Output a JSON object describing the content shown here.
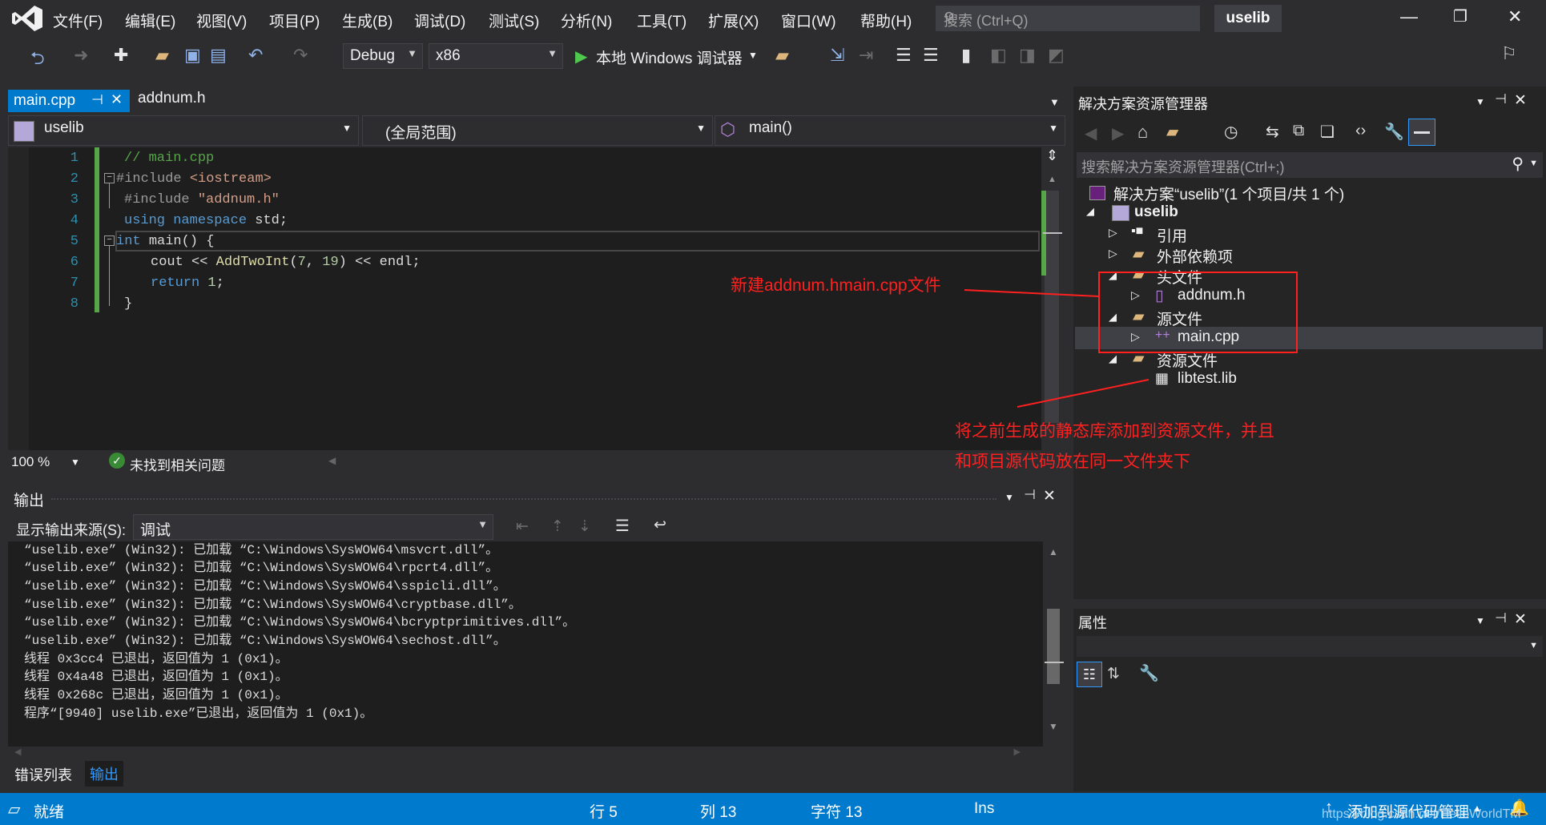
{
  "menu": [
    "文件(F)",
    "编辑(E)",
    "视图(V)",
    "项目(P)",
    "生成(B)",
    "调试(D)",
    "测试(S)",
    "分析(N)",
    "工具(T)",
    "扩展(X)",
    "窗口(W)",
    "帮助(H)"
  ],
  "search": {
    "placeholder": "搜索 (Ctrl+Q)"
  },
  "project_title": "uselib",
  "toolbar": {
    "config": "Debug",
    "platform": "x86",
    "debugger": "本地 Windows 调试器"
  },
  "editor": {
    "tabs": [
      {
        "label": "main.cpp",
        "active": true
      },
      {
        "label": "addnum.h",
        "active": false
      }
    ],
    "nav_project": "uselib",
    "nav_scope": "(全局范围)",
    "nav_member": "main()",
    "line_numbers": [
      "1",
      "2",
      "3",
      "4",
      "5",
      "6",
      "7",
      "8"
    ],
    "code": {
      "l1": "// main.cpp",
      "l2_kw": "#include",
      "l2_str": "<iostream>",
      "l3_kw": "#include",
      "l3_str": "\"addnum.h\"",
      "l4_using": "using",
      "l4_ns": "namespace",
      "l4_rest": "std;",
      "l5_int": "int",
      "l5_rest": "main() {",
      "l6_cout": "cout << ",
      "l6_fn": "AddTwoInt",
      "l6_args_open": "(",
      "l6_n1": "7",
      "l6_comma": ", ",
      "l6_n2": "19",
      "l6_end": ") << endl;",
      "l7_return": "return",
      "l7_n": "1",
      "l7_semi": ";",
      "l8": "}"
    },
    "zoom": "100 %",
    "issues": "未找到相关问题"
  },
  "output": {
    "title": "输出",
    "source_label": "显示输出来源(S):",
    "source_value": "调试",
    "lines": [
      "“uselib.exe” (Win32): 已加载 “C:\\Windows\\SysWOW64\\msvcrt.dll”。",
      "“uselib.exe” (Win32): 已加载 “C:\\Windows\\SysWOW64\\rpcrt4.dll”。",
      "“uselib.exe” (Win32): 已加载 “C:\\Windows\\SysWOW64\\sspicli.dll”。",
      "“uselib.exe” (Win32): 已加载 “C:\\Windows\\SysWOW64\\cryptbase.dll”。",
      "“uselib.exe” (Win32): 已加载 “C:\\Windows\\SysWOW64\\bcryptprimitives.dll”。",
      "“uselib.exe” (Win32): 已加载 “C:\\Windows\\SysWOW64\\sechost.dll”。",
      "线程 0x3cc4 已退出，返回值为 1 (0x1)。",
      "线程 0x4a48 已退出，返回值为 1 (0x1)。",
      "线程 0x268c 已退出，返回值为 1 (0x1)。",
      "程序“[9940] uselib.exe”已退出，返回值为 1 (0x1)。"
    ],
    "bottom_tabs": [
      "错误列表",
      "输出"
    ]
  },
  "solution_explorer": {
    "title": "解决方案资源管理器",
    "search_placeholder": "搜索解决方案资源管理器(Ctrl+;)",
    "solution": "解决方案“uselib”(1 个项目/共 1 个)",
    "project": "uselib",
    "references": "引用",
    "external_deps": "外部依赖项",
    "header_files": "头文件",
    "addnum": "addnum.h",
    "source_files": "源文件",
    "main": "main.cpp",
    "resource_files": "资源文件",
    "lib": "libtest.lib"
  },
  "properties": {
    "title": "属性"
  },
  "annotations": {
    "a1": "新建addnum.hmain.cpp文件",
    "a2_line1": "将之前生成的静态库添加到资源文件，并且",
    "a2_line2": "和项目源代码放在同一文件夹下"
  },
  "statusbar": {
    "ready": "就绪",
    "row": "行 5",
    "col": "列 13",
    "char": "字符 13",
    "ins": "Ins",
    "source_control": "添加到源代码管理",
    "watermark": "https://blog.csdn.net/HelloWorldTM"
  },
  "colors": {
    "accent": "#007acc",
    "annotation": "#ff2020",
    "background": "#2d2d30",
    "editor": "#1e1e1e"
  }
}
